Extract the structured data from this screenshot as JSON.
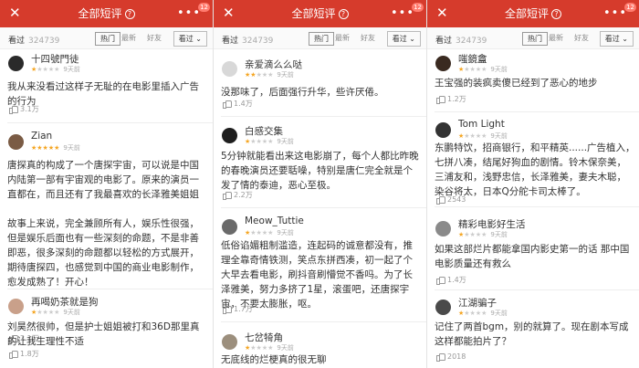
{
  "panels": [
    {
      "header": {
        "close": "✕",
        "title": "全部短评",
        "help": "?",
        "more": "•••",
        "badge": "12"
      },
      "filters": {
        "seen_label": "看过",
        "seen_count": "324739",
        "tab_hot": "热门",
        "tab_new": "最新",
        "tab_friends": "好友",
        "sort": "看过 ⌄"
      },
      "comments": [
        {
          "username": "十四號門徒",
          "stars_on": "★",
          "stars_off": "★★★★",
          "time": "9天前",
          "text": [
            "我从来没看过这样子无耻的在电影里插入广告的行为"
          ],
          "likes": "3.1万"
        },
        {
          "username": "Zian",
          "stars_on": "★★★★★",
          "stars_off": "",
          "time": "9天前",
          "text": [
            "唐探真的构成了一个唐探宇宙，可以说是中国内陆第一部有宇宙观的电影了。原来的演员一直都在，而且还有了我最喜欢的长泽雅美姐姐",
            "",
            "故事上来说，完全兼顾所有人，娱乐性很强，但是娱乐后面也有一些深刻的命题，不是非善即恶，很多深刻的命题都以轻松的方式展开，期待唐探四，也感觉到中国的商业电影制作，愈发成熟了！开心！"
          ],
          "likes": "2.1万"
        },
        {
          "username": "再喝奶茶就是狗",
          "stars_on": "★",
          "stars_off": "★★★★",
          "time": "9天前",
          "text": [
            "刘昊然很帅，但是护士姐姐被打和36D那里真的让我生理性不适"
          ],
          "likes": "1.8万"
        }
      ]
    },
    {
      "header": {
        "close": "✕",
        "title": "全部短评",
        "help": "?",
        "more": "•••",
        "badge": "12"
      },
      "filters": {
        "seen_label": "看过",
        "seen_count": "324739",
        "tab_hot": "热门",
        "tab_new": "最新",
        "tab_friends": "好友",
        "sort": "看过 ⌄"
      },
      "comments": [
        {
          "username": "亲爱滴么么哒",
          "stars_on": "★★",
          "stars_off": "★★★",
          "time": "9天前",
          "text": [
            "没那味了，后面强行升华，些许厌倦。"
          ],
          "likes": "1.4万"
        },
        {
          "username": "白感交集",
          "stars_on": "★",
          "stars_off": "★★★★",
          "time": "9天前",
          "text": [
            "5分钟就能看出来这电影崩了，每个人都比昨晚的春晚演员还要聒噪，特别是唐仁完全就是个发了情的泰迪，恶心至极。"
          ],
          "likes": "2.2万"
        },
        {
          "username": "Meow_Tuttie",
          "stars_on": "★",
          "stars_off": "★★★★",
          "time": "9天前",
          "text": [
            "低俗谄媚粗制滥造，连起码的诚意都没有，推理全靠奇情铁测，笑点东拼西凑，初一起了个大早去看电影，刷抖音刷懵觉不香吗。为了长泽雅美，努力多挤了1星，滚蛋吧，还唐探宇宙，不要太膨胀，呕。"
          ],
          "likes": "1.7万"
        },
        {
          "username": "七岔犄角",
          "stars_on": "★",
          "stars_off": "★★★★",
          "time": "9天前",
          "text": [
            "无底线的烂梗真的很无聊"
          ],
          "likes": ""
        }
      ]
    },
    {
      "header": {
        "close": "✕",
        "title": "全部短评",
        "help": "?",
        "more": "•••",
        "badge": "12"
      },
      "filters": {
        "seen_label": "看过",
        "seen_count": "324739",
        "tab_hot": "热门",
        "tab_new": "最新",
        "tab_friends": "好友",
        "sort": "看过 ⌄"
      },
      "comments": [
        {
          "username": "嗤鏡盦",
          "stars_on": "★",
          "stars_off": "★★★★",
          "time": "9天前",
          "text": [
            "王宝强的装疯卖傻已经到了恶心的地步"
          ],
          "likes": "1.2万"
        },
        {
          "username": "Tom Light",
          "stars_on": "★",
          "stars_off": "★★★★",
          "time": "9天前",
          "text": [
            "东鹏特饮，招商银行，和平精英......广告植入，七拼八凑，结尾好狗血的剧情。铃木保奈美，三浦友和，浅野忠信，长泽雅美，妻夫木聪，染谷将太，日本Q分舵卡司太棒了。"
          ],
          "likes": "2543"
        },
        {
          "username": "精彩电影好生活",
          "stars_on": "★",
          "stars_off": "★★★★",
          "time": "9天前",
          "text": [
            "如果这部烂片都能拿国内影史第一的话 那中国电影质量还有救么"
          ],
          "likes": "1.4万"
        },
        {
          "username": "江湖骗子",
          "stars_on": "★",
          "stars_off": "★★★★",
          "time": "9天前",
          "text": [
            "记住了两首bgm，别的就算了。现在剧本写成这样都能拍片了？"
          ],
          "likes": "2018"
        }
      ]
    }
  ],
  "colors": {
    "header_red": "#d63b2c",
    "star_gold": "#f5a623"
  }
}
